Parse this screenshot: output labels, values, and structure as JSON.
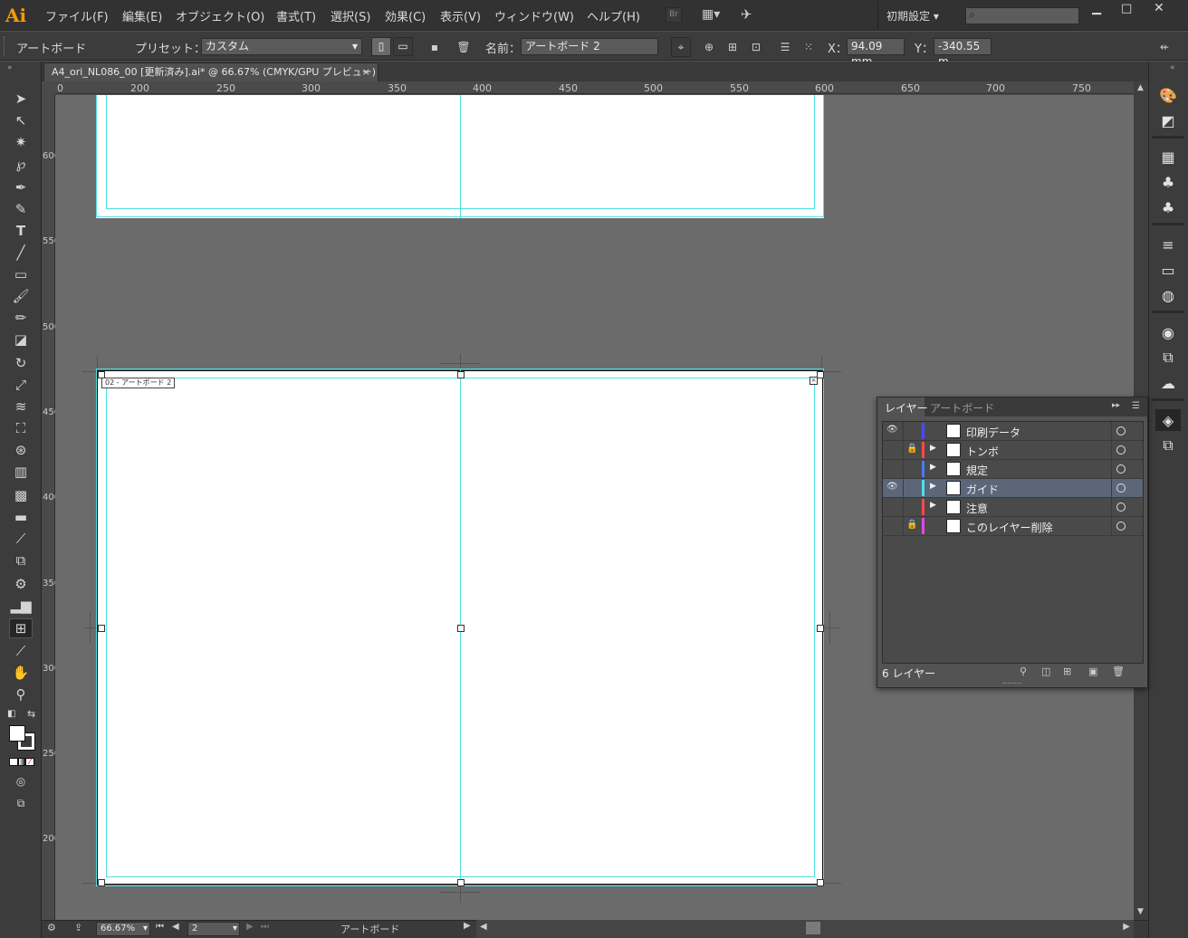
{
  "app": {
    "logo": "Ai"
  },
  "menubar": {
    "items": [
      "ファイル(F)",
      "編集(E)",
      "オブジェクト(O)",
      "書式(T)",
      "選択(S)",
      "効果(C)",
      "表示(V)",
      "ウィンドウ(W)",
      "ヘルプ(H)"
    ],
    "bridge": "Br",
    "workspace": "初期設定"
  },
  "control": {
    "artboard_label": "アートボード",
    "preset_label": "プリセット：",
    "preset_value": "カスタム",
    "name_label": "名前：",
    "name_value": "アートボード 2",
    "x_label": "X：",
    "x_value": "94.09 mm",
    "y_label": "Y：",
    "y_value": "-340.55 m"
  },
  "document": {
    "tab_title": "A4_ori_NL086_00 [更新済み].ai* @ 66.67% (CMYK/GPU プレビュー)",
    "close": "×",
    "artboard_label": "02 - アートボード 2"
  },
  "rulers": {
    "horizontal": [
      "0",
      "200",
      "250",
      "300",
      "350",
      "400",
      "450",
      "500",
      "550",
      "600",
      "650",
      "700",
      "750"
    ],
    "vertical": [
      "600",
      "550",
      "500",
      "450",
      "400",
      "350",
      "300",
      "250",
      "200"
    ]
  },
  "status": {
    "zoom": "66.67%",
    "page": "2",
    "mode": "アートボード"
  },
  "layers_panel": {
    "tabs": [
      "レイヤー",
      "アートボード"
    ],
    "layers": [
      {
        "name": "印刷データ",
        "color": "#4a4aff",
        "visible": true,
        "locked": false,
        "expandable": false,
        "selected": false
      },
      {
        "name": "トンボ",
        "color": "#ff4a4a",
        "visible": false,
        "locked": true,
        "expandable": true,
        "selected": false
      },
      {
        "name": "規定",
        "color": "#4a7aff",
        "visible": false,
        "locked": false,
        "expandable": true,
        "selected": false
      },
      {
        "name": "ガイド",
        "color": "#4ae0e0",
        "visible": true,
        "locked": false,
        "expandable": true,
        "selected": true
      },
      {
        "name": "注意",
        "color": "#ff4a4a",
        "visible": false,
        "locked": false,
        "expandable": true,
        "selected": false
      },
      {
        "name": "このレイヤー削除",
        "color": "#e04ae0",
        "visible": false,
        "locked": true,
        "expandable": false,
        "selected": false
      }
    ],
    "count": "6 レイヤー"
  },
  "colors": {
    "guide": "#4ee0e0",
    "canvas": "#6b6b6b",
    "selected_row": "#5b6679"
  }
}
